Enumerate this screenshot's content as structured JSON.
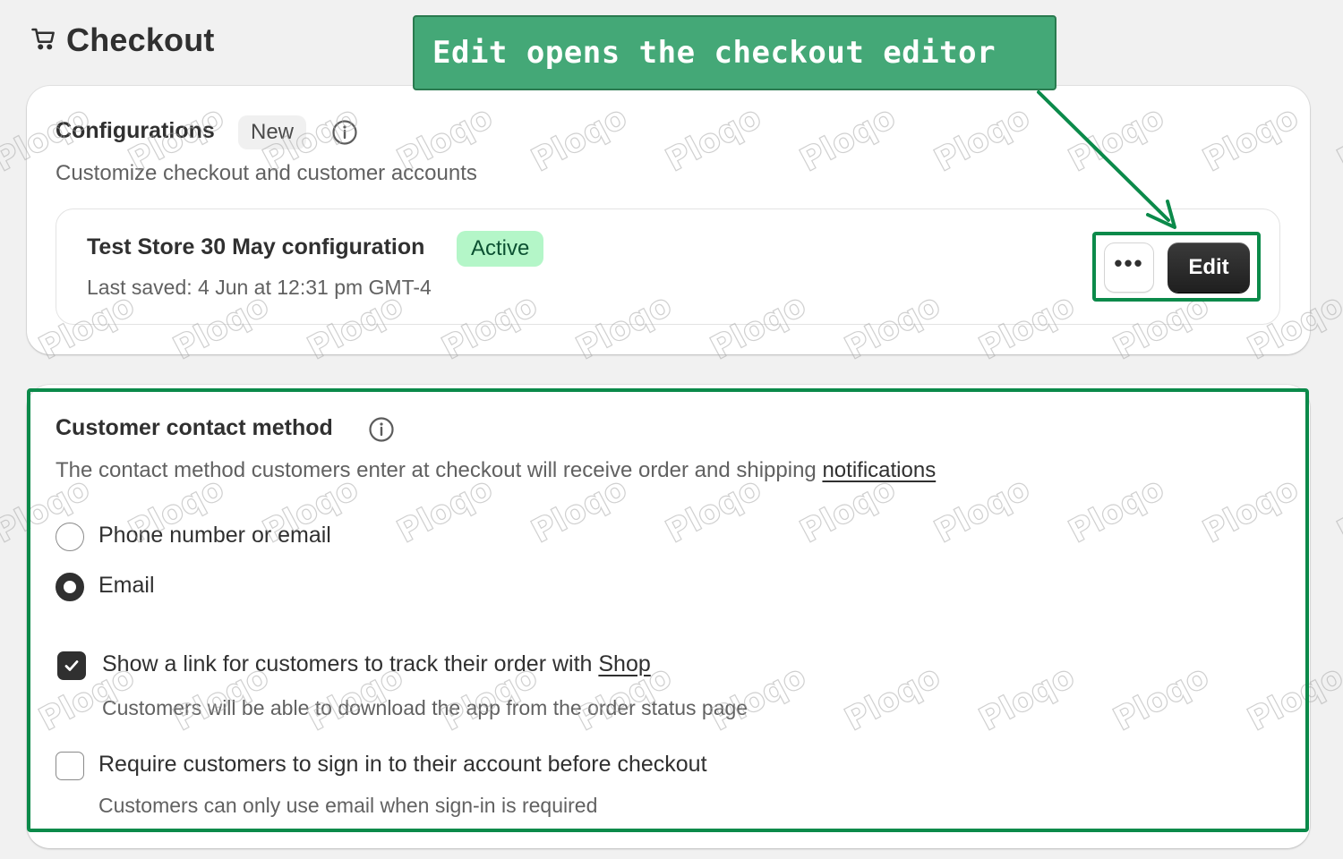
{
  "page": {
    "title": "Checkout",
    "icon": "cart-icon"
  },
  "callout": {
    "text": "Edit opens the checkout editor",
    "color": "#44a877"
  },
  "configurations": {
    "title": "Configurations",
    "badge": "New",
    "description": "Customize checkout and customer accounts",
    "config": {
      "name": "Test Store 30 May configuration",
      "status": "Active",
      "last_saved": "Last saved: 4 Jun at 12:31 pm GMT-4",
      "more_label": "•••",
      "edit_label": "Edit"
    }
  },
  "contact_method": {
    "title": "Customer contact method",
    "description_prefix": "The contact method customers enter at checkout will receive order and shipping ",
    "description_link": "notifications",
    "options": [
      {
        "label": "Phone number or email",
        "selected": false
      },
      {
        "label": "Email",
        "selected": true
      }
    ],
    "track_link": {
      "label_prefix": "Show a link for customers to track their order with ",
      "label_link": "Shop",
      "checked": true,
      "help": "Customers will be able to download the app from the order status page"
    },
    "require_signin": {
      "label": "Require customers to sign in to their account before checkout",
      "checked": false,
      "help": "Customers can only use email when sign-in is required"
    }
  },
  "watermark": "Ploqo",
  "colors": {
    "highlight": "#0b8a4a",
    "active_badge": "#b4f6c8"
  }
}
